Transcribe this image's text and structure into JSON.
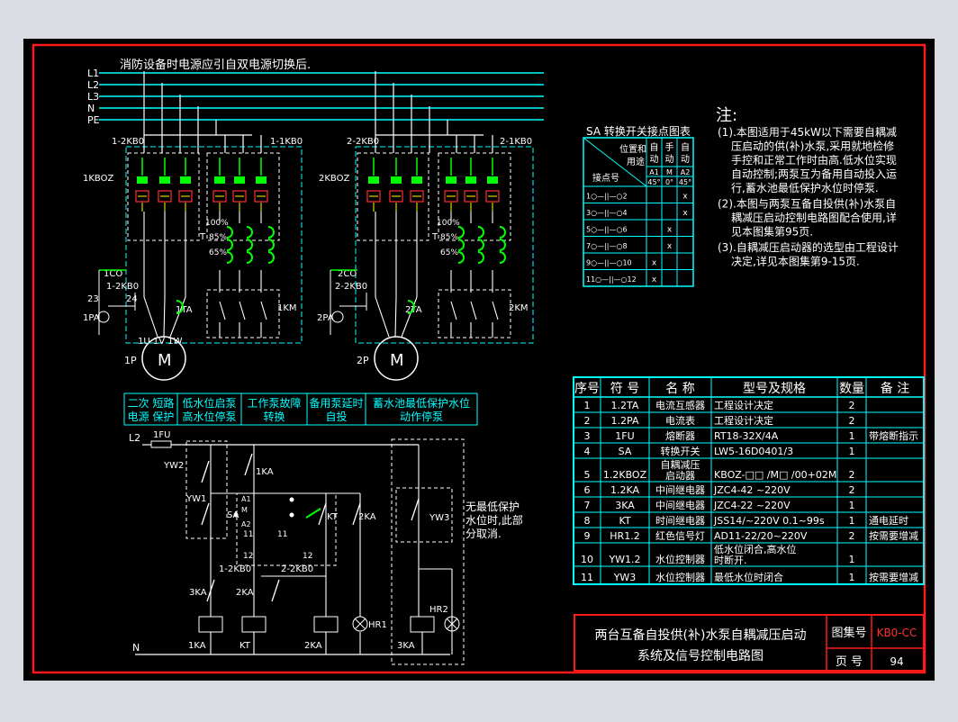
{
  "colors": {
    "background": "#d9dde3",
    "canvas": "#000000",
    "frame": "#ff1a1a",
    "cyan": "#00ffff",
    "white": "#ffffff",
    "green": "#00ff00",
    "yellow": "#ffff00",
    "red": "#ff3030"
  },
  "main": {
    "header_note": "消防设备时电源应引自双电源切换后.",
    "buses": [
      "L1",
      "L2",
      "L3",
      "N",
      "PE"
    ],
    "unit1": {
      "left_breaker": "1-2KB0",
      "right_breaker": "1-1KB0",
      "starter": "1KBOZ",
      "ct_label": "1CO",
      "ct2_label": "1-2KB0",
      "term23": "23",
      "term24": "24",
      "ammeter": "1PA",
      "ta": "1TA",
      "motor_terms": "1U 1V 1W",
      "pump": "1P",
      "contactor": "1KM"
    },
    "unit2": {
      "left_breaker": "2-2KB0",
      "right_breaker": "2-1KB0",
      "starter": "2KBOZ",
      "ct_label": "2CO",
      "ct2_label": "2-2KB0",
      "ammeter": "2PA",
      "ta": "2TA",
      "pump": "2P",
      "contactor": "2KM"
    },
    "taps": [
      "100%",
      "85%",
      "65%"
    ],
    "transformer": "T",
    "motor_symbol": "M",
    "control_headers": [
      "二次 短路\n电源 保护",
      "低水位启泵\n高水位停泵",
      "工作泵故障\n转换",
      "备用泵延时\n自投",
      "蓄水池最低保护水位\n动作停泵"
    ],
    "control": {
      "l2": "L2",
      "fuse": "1FU",
      "n": "N",
      "yw2": "YW2",
      "yw1": "YW1",
      "yw3": "YW3",
      "ka1_contact": "1KA",
      "sa": "SA",
      "kt": "KT",
      "ka2_contact": "2KA",
      "ka3_contact": "3KA",
      "kb0_1": "1-2KB0",
      "kb0_2": "2-2KB0",
      "a1": "A1",
      "m": "M",
      "a2": "A2",
      "n12": "12",
      "n11": "11",
      "coil_1ka": "1KA",
      "coil_kt": "KT",
      "coil_2ka": "2KA",
      "coil_3ka": "3KA",
      "hr1": "HR1",
      "hr2": "HR2",
      "note": "无最低保护\n水位时,此部\n分取消."
    }
  },
  "sa_table": {
    "title": "SA 转换开关接点图表",
    "corner_top": "位置和",
    "corner_mid": "用途",
    "corner_bottom": "接点号",
    "columns": [
      {
        "name": "自动",
        "code": "A1",
        "angle": "45°"
      },
      {
        "name": "手动",
        "code": "M",
        "angle": "0°"
      },
      {
        "name": "自动",
        "code": "A2",
        "angle": "45°"
      }
    ],
    "rows": [
      {
        "contact": "1○—||—○2",
        "marks": [
          "",
          "",
          "x"
        ]
      },
      {
        "contact": "3○—||—○4",
        "marks": [
          "",
          "",
          "x"
        ]
      },
      {
        "contact": "5○—||—○6",
        "marks": [
          "",
          "x",
          ""
        ]
      },
      {
        "contact": "7○—||—○8",
        "marks": [
          "",
          "x",
          ""
        ]
      },
      {
        "contact": "9○—||—○10",
        "marks": [
          "x",
          "",
          ""
        ]
      },
      {
        "contact": "11○—||—○12",
        "marks": [
          "x",
          "",
          ""
        ]
      }
    ]
  },
  "notes": {
    "title": "注:",
    "items": [
      [
        "(1).本图适用于45kW以下需要自耦减",
        "压启动的供(补)水泵,采用就地检修",
        "手控和正常工作时由高.低水位实现",
        "自动控制;两泵互为备用自动投入运",
        "行,蓄水池最低保护水位时停泵."
      ],
      [
        "(2).本图与两泵互备自投供(补)水泵自",
        "耦减压启动控制电路图配合使用,详",
        "见本图集第95页."
      ],
      [
        "(3).自耦减压启动器的选型由工程设计",
        "决定,详见本图集第9-15页."
      ]
    ]
  },
  "parts": {
    "headers": [
      "序号",
      "符 号",
      "名 称",
      "型号及规格",
      "数量",
      "备 注"
    ],
    "rows": [
      [
        "1",
        "1.2TA",
        "电流互感器",
        "工程设计决定",
        "2",
        ""
      ],
      [
        "2",
        "1.2PA",
        "电流表",
        "工程设计决定",
        "2",
        ""
      ],
      [
        "3",
        "1FU",
        "熔断器",
        "RT18-32X/4A",
        "1",
        "带熔断指示"
      ],
      [
        "4",
        "SA",
        "转换开关",
        "LW5-16D0401/3",
        "1",
        ""
      ],
      [
        "5",
        "1.2KBOZ",
        "自耦减压\n启动器",
        "KBOZ-□□ /M□ /00+02M",
        "2",
        ""
      ],
      [
        "6",
        "1.2KA",
        "中间继电器",
        "JZC4-42 ~220V",
        "2",
        ""
      ],
      [
        "7",
        "3KA",
        "中间继电器",
        "JZC4-22 ~220V",
        "1",
        ""
      ],
      [
        "8",
        "KT",
        "时间继电器",
        "JSS14/~220V 0.1~99s",
        "1",
        "通电延时"
      ],
      [
        "9",
        "HR1.2",
        "红色信号灯",
        "AD11-22/20~220V",
        "2",
        "按需要增减"
      ],
      [
        "10",
        "YW1.2",
        "水位控制器",
        "低水位闭合,高水位\n时断开.",
        "1",
        ""
      ],
      [
        "11",
        "YW3",
        "水位控制器",
        "最低水位时闭合",
        "1",
        "按需要增减"
      ]
    ]
  },
  "title_block": {
    "title_line1": "两台互备自投供(补)水泵自耦减压启动",
    "title_line2": "系统及信号控制电路图",
    "atlas_label": "图集号",
    "atlas_value": "KB0-CC",
    "page_label": "页 号",
    "page_value": "94"
  }
}
